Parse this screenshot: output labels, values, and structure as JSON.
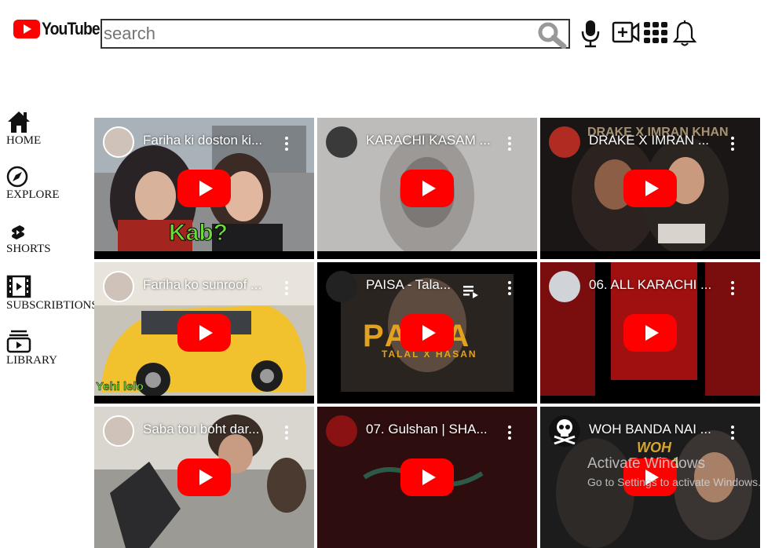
{
  "header": {
    "logo_text": "YouTube",
    "search_placeholder": "search",
    "icons": [
      "search-icon",
      "mic-icon",
      "create-video-icon",
      "apps-grid-icon",
      "bell-icon"
    ]
  },
  "sidebar": {
    "items": [
      {
        "label": "HOME",
        "icon": "home-icon"
      },
      {
        "label": "EXPLORE",
        "icon": "compass-icon"
      },
      {
        "label": "SHORTS",
        "icon": "shorts-icon"
      },
      {
        "label": "SUBSCRIBTIONS",
        "icon": "film-icon"
      },
      {
        "label": "LIBRARY",
        "icon": "library-icon"
      }
    ]
  },
  "videos": [
    {
      "title": "Fariha ki doston ki...",
      "overlay": "Kab?"
    },
    {
      "title": "KARACHI KASAM ..."
    },
    {
      "title": "DRAKE X IMRAN ...",
      "overlay": "DRAKE X IMRAN KHAN"
    },
    {
      "title": "Fariha ko sunroof ...",
      "overlay": "Yehi lelo"
    },
    {
      "title": "PAISA - Tala...",
      "overlay": "PAISA",
      "overlay2": "TALAL X HASAN"
    },
    {
      "title": "06. ALL KARACHI ..."
    },
    {
      "title": "Saba tou boht dar..."
    },
    {
      "title": "07. Gulshan | SHA..."
    },
    {
      "title": "WOH BANDA NAI ...",
      "overlay": "WOH BANDA"
    }
  ],
  "watermark": {
    "line1": "Activate Windows",
    "line2": "Go to Settings to activate Windows."
  },
  "colors": {
    "brand": "#ff0000",
    "text": "#111111"
  }
}
